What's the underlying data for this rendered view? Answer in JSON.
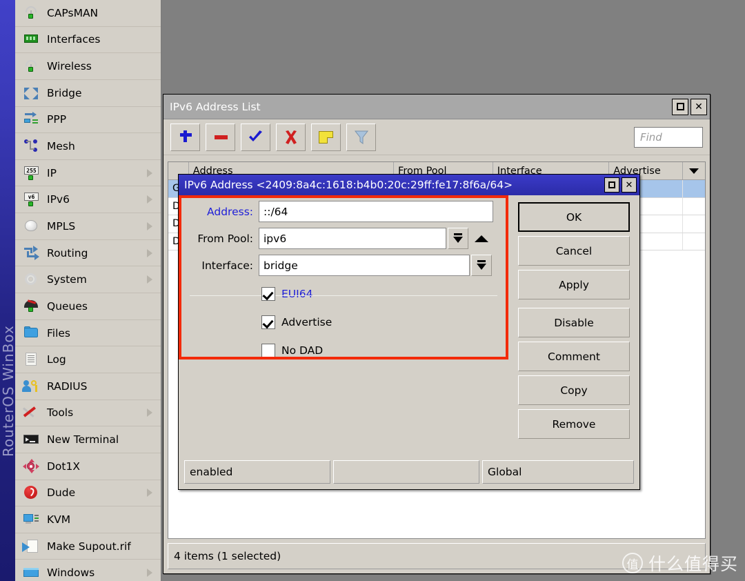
{
  "brand": {
    "vertical_text": "RouterOS WinBox"
  },
  "sidebar": {
    "items": [
      {
        "label": "CAPsMAN",
        "icon": "capsman-icon",
        "arrow": false
      },
      {
        "label": "Interfaces",
        "icon": "interfaces-icon",
        "arrow": false
      },
      {
        "label": "Wireless",
        "icon": "wireless-icon",
        "arrow": false
      },
      {
        "label": "Bridge",
        "icon": "bridge-icon",
        "arrow": false
      },
      {
        "label": "PPP",
        "icon": "ppp-icon",
        "arrow": false
      },
      {
        "label": "Mesh",
        "icon": "mesh-icon",
        "arrow": false
      },
      {
        "label": "IP",
        "icon": "ip-icon",
        "arrow": true
      },
      {
        "label": "IPv6",
        "icon": "ipv6-icon",
        "arrow": true
      },
      {
        "label": "MPLS",
        "icon": "mpls-icon",
        "arrow": true
      },
      {
        "label": "Routing",
        "icon": "routing-icon",
        "arrow": true
      },
      {
        "label": "System",
        "icon": "system-icon",
        "arrow": true
      },
      {
        "label": "Queues",
        "icon": "queues-icon",
        "arrow": false
      },
      {
        "label": "Files",
        "icon": "files-icon",
        "arrow": false
      },
      {
        "label": "Log",
        "icon": "log-icon",
        "arrow": false
      },
      {
        "label": "RADIUS",
        "icon": "radius-icon",
        "arrow": false
      },
      {
        "label": "Tools",
        "icon": "tools-icon",
        "arrow": true
      },
      {
        "label": "New Terminal",
        "icon": "terminal-icon",
        "arrow": false
      },
      {
        "label": "Dot1X",
        "icon": "dot1x-icon",
        "arrow": false
      },
      {
        "label": "Dude",
        "icon": "dude-icon",
        "arrow": true
      },
      {
        "label": "KVM",
        "icon": "kvm-icon",
        "arrow": false
      },
      {
        "label": "Make Supout.rif",
        "icon": "supout-icon",
        "arrow": false
      },
      {
        "label": "Windows",
        "icon": "windows-icon",
        "arrow": true
      }
    ],
    "ip_icon_text": "255",
    "ipv6_icon_text": "v6"
  },
  "address_list_window": {
    "title": "IPv6 Address List",
    "maximize_label": "",
    "close_label": "✕",
    "toolbar": {
      "add_label": "+",
      "remove_label": "−",
      "enable_label": "✔",
      "disable_label": "✖",
      "comment_label": "",
      "filter_label": ""
    },
    "find": {
      "placeholder": "Find",
      "value": ""
    },
    "table": {
      "columns": [
        "",
        "Address",
        "From Pool",
        "Interface",
        "Advertise"
      ],
      "rows": [
        {
          "flag": "G",
          "address": "",
          "from_pool": "",
          "interface": "",
          "advertise": ""
        },
        {
          "flag": "D",
          "address": "",
          "from_pool": "",
          "interface": "",
          "advertise": ""
        },
        {
          "flag": "D",
          "address": "",
          "from_pool": "",
          "interface": "",
          "advertise": ""
        },
        {
          "flag": "D",
          "address": "",
          "from_pool": "",
          "interface": "",
          "advertise": ""
        }
      ]
    },
    "status": "4 items (1 selected)"
  },
  "address_dialog": {
    "title": "IPv6 Address <2409:8a4c:1618:b4b0:20c:29ff:fe17:8f6a/64>",
    "maximize_label": "",
    "close_label": "✕",
    "fields": {
      "address": {
        "label": "Address:",
        "value": "::/64"
      },
      "from_pool": {
        "label": "From Pool:",
        "value": "ipv6"
      },
      "interface": {
        "label": "Interface:",
        "value": "bridge"
      }
    },
    "checkboxes": [
      {
        "label": "EUI64",
        "checked": true,
        "link": true
      },
      {
        "label": "Advertise",
        "checked": true,
        "link": false
      },
      {
        "label": "No DAD",
        "checked": false,
        "link": false
      }
    ],
    "buttons": [
      "OK",
      "Cancel",
      "Apply",
      "Disable",
      "Comment",
      "Copy",
      "Remove"
    ],
    "status": {
      "state": "enabled",
      "middle": "",
      "scope": "Global"
    }
  },
  "watermark": {
    "mark": "值",
    "text": "什么值得买"
  },
  "colors": {
    "desktop": "#808080",
    "window_face": "#d4d0c8",
    "dialog_titlebar": "#2b2ba8",
    "inactive_titlebar": "#a8a8a8",
    "selection": "#a6c5ea",
    "highlight_rect": "#f32a0a",
    "link_text": "#2020d8",
    "brand_strip": "#2424a0"
  }
}
